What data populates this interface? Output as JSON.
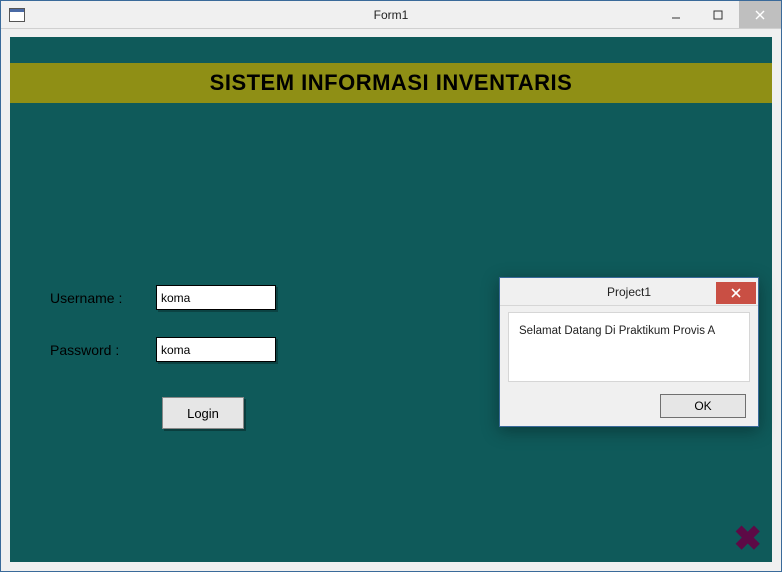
{
  "window": {
    "title": "Form1"
  },
  "banner": {
    "title": "SISTEM INFORMASI INVENTARIS"
  },
  "form": {
    "username_label": "Username :",
    "username_value": "koma",
    "password_label": "Password :",
    "password_value": "koma",
    "login_label": "Login"
  },
  "dialog": {
    "title": "Project1",
    "message": "Selamat Datang Di Praktikum Provis A",
    "ok_label": "OK"
  }
}
